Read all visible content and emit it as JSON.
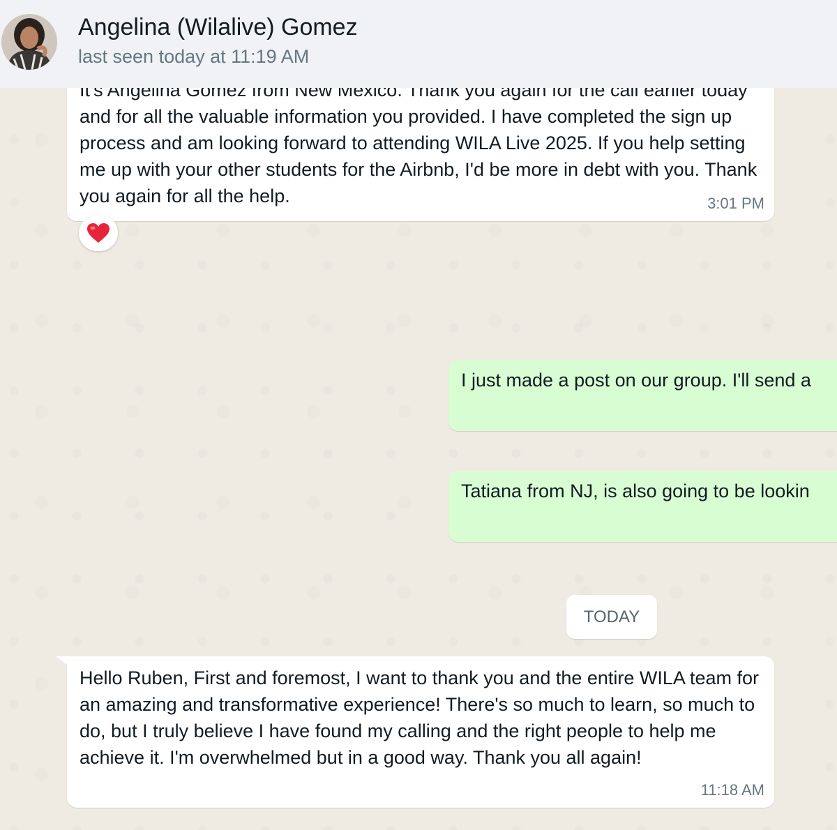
{
  "header": {
    "contact_name": "Angelina (Wilalive) Gomez",
    "last_seen": "last seen today at 11:19 AM"
  },
  "messages": [
    {
      "direction": "incoming",
      "text": "It's Angelina Gomez from New Mexico. Thank you again for the call earlier today and for all the valuable information you provided. I have completed the sign up process and am looking forward to attending WILA Live 2025. If you help setting me up with your other students for the Airbnb, I'd be more in debt with you. Thank you again for all the help.",
      "time": "3:01 PM",
      "reaction": "❤️"
    },
    {
      "direction": "outgoing",
      "text": "I just made a post on our group. I'll send a"
    },
    {
      "direction": "outgoing",
      "text": "Tatiana from NJ, is also going to be lookin"
    },
    {
      "direction": "incoming",
      "text": "Hello Ruben, First and foremost, I want to thank you and the entire WILA team for an amazing and transformative experience! There's so much to learn, so much to do, but I truly believe I have found my calling and the right people to help me achieve it. I'm overwhelmed but in a good way. Thank you all again!",
      "time": "11:18 AM"
    }
  ],
  "date_separator": "TODAY",
  "colors": {
    "background": "#efeae2",
    "header": "#f0f2f5",
    "incoming_bubble": "#ffffff",
    "outgoing_bubble": "#d9fdd3",
    "meta_text": "#667781"
  },
  "icons": {
    "avatar": "contact-avatar-photo",
    "reaction": "red-heart-icon"
  }
}
